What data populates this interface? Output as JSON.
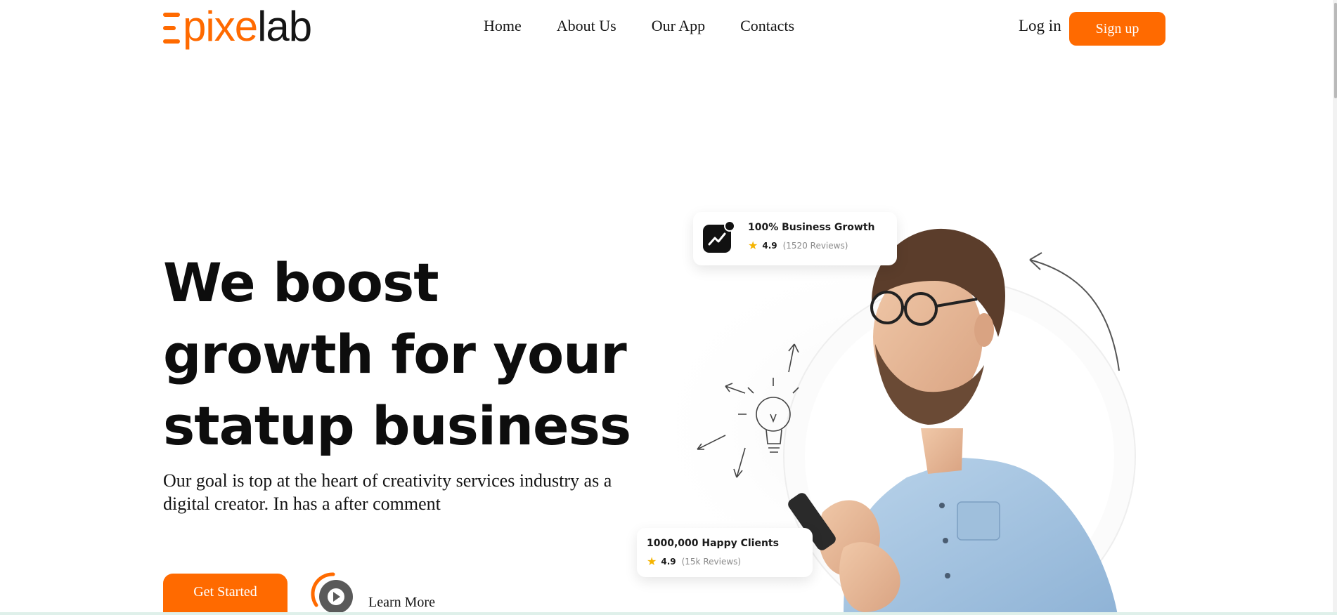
{
  "header": {
    "logo": {
      "accent_text": "pixe",
      "dark_text": "lab"
    },
    "nav": [
      {
        "label": "Home"
      },
      {
        "label": "About Us"
      },
      {
        "label": "Our App"
      },
      {
        "label": "Contacts"
      }
    ],
    "login_label": "Log in",
    "signup_label": "Sign up"
  },
  "hero": {
    "title_line1": "We boost",
    "title_line2": "growth for your",
    "title_line3": "statup business",
    "subtitle": "Our goal is top at the heart of creativity services industry as a digital creator. In has a after comment",
    "get_started_label": "Get Started",
    "learn_more_label": "Learn More"
  },
  "cards": {
    "growth": {
      "title": "100% Business Growth",
      "rating": "4.9",
      "reviews": "(1520 Reviews)",
      "icon": "trend-up-icon"
    },
    "clients": {
      "title": "1000,000 Happy Clients",
      "rating": "4.9",
      "reviews": "(15k Reviews)"
    }
  },
  "colors": {
    "accent": "#ff6a00",
    "text": "#151515",
    "background": "#ffffff",
    "star": "#f5b400"
  }
}
